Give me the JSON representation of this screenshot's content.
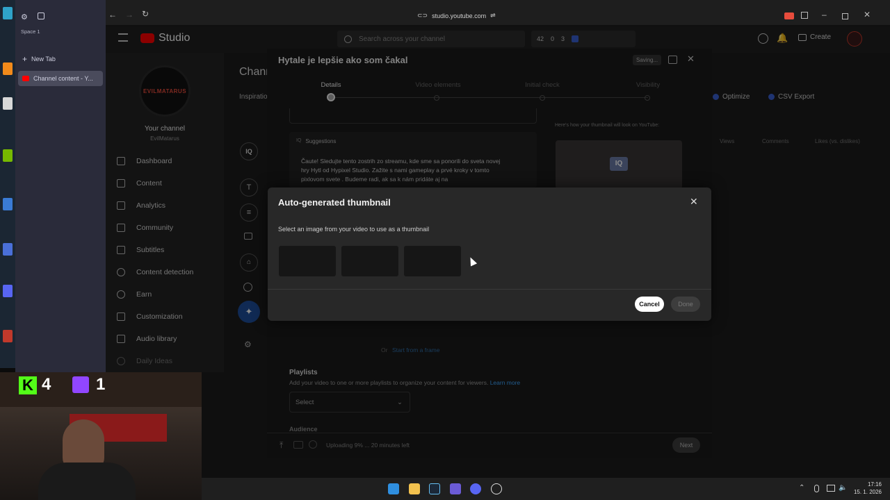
{
  "browser": {
    "space_label": "Space 1",
    "new_tab_label": "New Tab",
    "active_tab_label": "Channel content - Y...",
    "url": "studio.youtube.com"
  },
  "studio": {
    "logo_text": "Studio",
    "search_placeholder": "Search across your channel",
    "stats": [
      "42",
      "0",
      "3"
    ],
    "create_label": "Create",
    "channel_label": "Your channel",
    "channel_name": "EvilMatarus",
    "channel_logo_text": "EVILMATARUS",
    "page_title": "Chann",
    "inspiration_label": "Inspiratio",
    "optimize_label": "Optimize",
    "csv_label": "CSV Export",
    "table_headers": [
      "Views",
      "Comments",
      "Likes (vs. dislikes)"
    ],
    "nav": [
      {
        "label": "Dashboard",
        "icon": "dashboard-icon"
      },
      {
        "label": "Content",
        "icon": "content-icon"
      },
      {
        "label": "Analytics",
        "icon": "analytics-icon"
      },
      {
        "label": "Community",
        "icon": "community-icon"
      },
      {
        "label": "Subtitles",
        "icon": "subtitles-icon"
      },
      {
        "label": "Content detection",
        "icon": "copyright-icon"
      },
      {
        "label": "Earn",
        "icon": "dollar-icon"
      },
      {
        "label": "Customization",
        "icon": "wand-icon"
      },
      {
        "label": "Audio library",
        "icon": "audio-icon"
      },
      {
        "label": "Daily Ideas",
        "icon": "ideas-icon"
      }
    ]
  },
  "details": {
    "video_title": "Hytale je lepšie ako som čakal",
    "saving_label": "Saving...",
    "steps": [
      "Details",
      "Video elements",
      "Initial check",
      "Visibility"
    ],
    "suggestions_label": "Suggestions",
    "suggestion_text": "Čaute! Sledujte tento zostrih zo streamu, kde sme sa ponorili do sveta novej hry Hytl od Hypixel Studio. Zažite s nami gameplay a prvé kroky v tomto pixlovom svete . Budeme radi, ak sa k nám pridáte aj na",
    "thumb_preview_label": "Here's how your thumbnail will look on YouTube:",
    "or_label": "Or",
    "start_frame_label": "Start from a frame",
    "playlists_title": "Playlists",
    "playlists_desc": "Add your video to one or more playlists to organize your content for viewers.",
    "learn_more": "Learn more",
    "select_label": "Select",
    "audience_label": "Audience",
    "upload_status": "Uploading 9% ... 20 minutes left",
    "next_label": "Next"
  },
  "dialog": {
    "title": "Auto-generated thumbnail",
    "subtitle": "Select an image from your video to use as a thumbnail",
    "cancel_label": "Cancel",
    "done_label": "Done"
  },
  "overlay": {
    "kick_count": "4",
    "twitch_count": "1"
  },
  "taskbar": {
    "time": "17:16",
    "date": "15. 1. 2026"
  },
  "colors": {
    "accent_blue": "#3ea6ff",
    "youtube_red": "#ff0000",
    "kick_green": "#53fc18",
    "twitch_purple": "#9146ff"
  }
}
